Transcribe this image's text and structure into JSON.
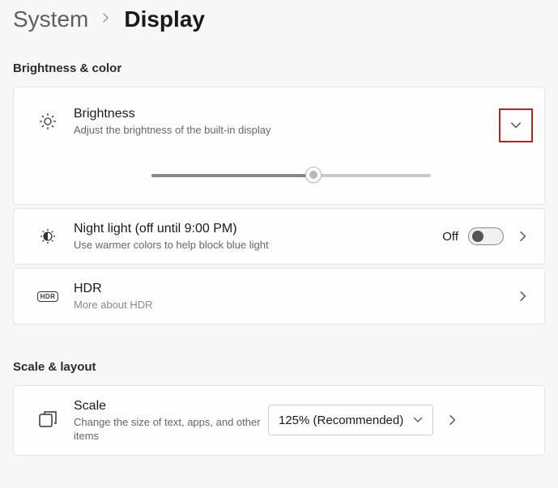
{
  "breadcrumb": {
    "parent": "System",
    "current": "Display"
  },
  "sections": {
    "brightness_color": {
      "header": "Brightness & color"
    },
    "scale_layout": {
      "header": "Scale & layout"
    }
  },
  "brightness": {
    "title": "Brightness",
    "subtitle": "Adjust the brightness of the built-in display",
    "slider_percent": 58
  },
  "night_light": {
    "title": "Night light (off until 9:00 PM)",
    "subtitle": "Use warmer colors to help block blue light",
    "toggle_label": "Off",
    "toggle_on": false
  },
  "hdr": {
    "title": "HDR",
    "subtitle": "More about HDR",
    "badge": "HDR"
  },
  "scale": {
    "title": "Scale",
    "subtitle": "Change the size of text, apps, and other items",
    "selected": "125% (Recommended)"
  }
}
